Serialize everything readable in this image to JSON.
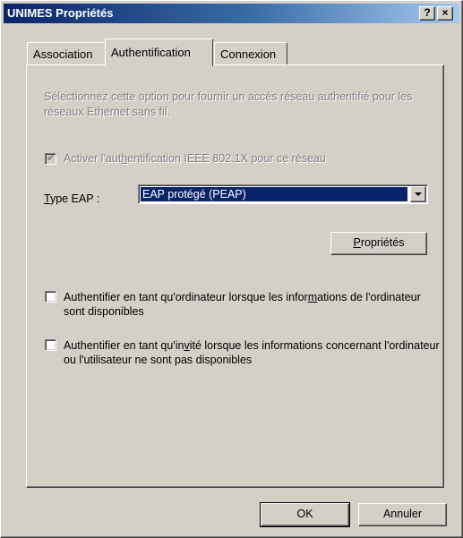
{
  "window": {
    "title": "UNIMES Propriétés",
    "help_label": "?",
    "close_label": "×"
  },
  "tabs": [
    {
      "label": "Association",
      "active": false
    },
    {
      "label": "Authentification",
      "active": true
    },
    {
      "label": "Connexion",
      "active": false
    }
  ],
  "panel": {
    "description": "Sélectionnez cette option pour fournir un accès réseau authentifié pour les réseaux Ethernet sans fil.",
    "enable_8021x": {
      "label_pre": "Activer l'aut",
      "label_key": "h",
      "label_post": "entification IEEE 802.1X pour ce réseau",
      "checked": true,
      "disabled": true
    },
    "eap_type": {
      "label_key": "T",
      "label_post": "ype EAP :",
      "selected": "EAP protégé (PEAP)"
    },
    "properties_button": {
      "label_key": "P",
      "label_post": "ropriétés"
    },
    "auth_as_computer": {
      "label_pre": "Authentifier en tant qu'ordinateur lorsque les infor",
      "label_key": "m",
      "label_post": "ations de l'ordinateur sont disponibles",
      "checked": false
    },
    "auth_as_guest": {
      "label_pre": "Authentifier en tant qu'in",
      "label_key": "v",
      "label_post": "ité lorsque les informations concernant l'ordinateur ou l'utilisateur ne sont pas disponibles",
      "checked": false
    }
  },
  "footer": {
    "ok_label": "OK",
    "cancel_label": "Annuler"
  },
  "colors": {
    "face": "#d4d0c8",
    "title_start": "#0a246a",
    "title_end": "#a6caf0",
    "disabled_text": "#808080"
  }
}
